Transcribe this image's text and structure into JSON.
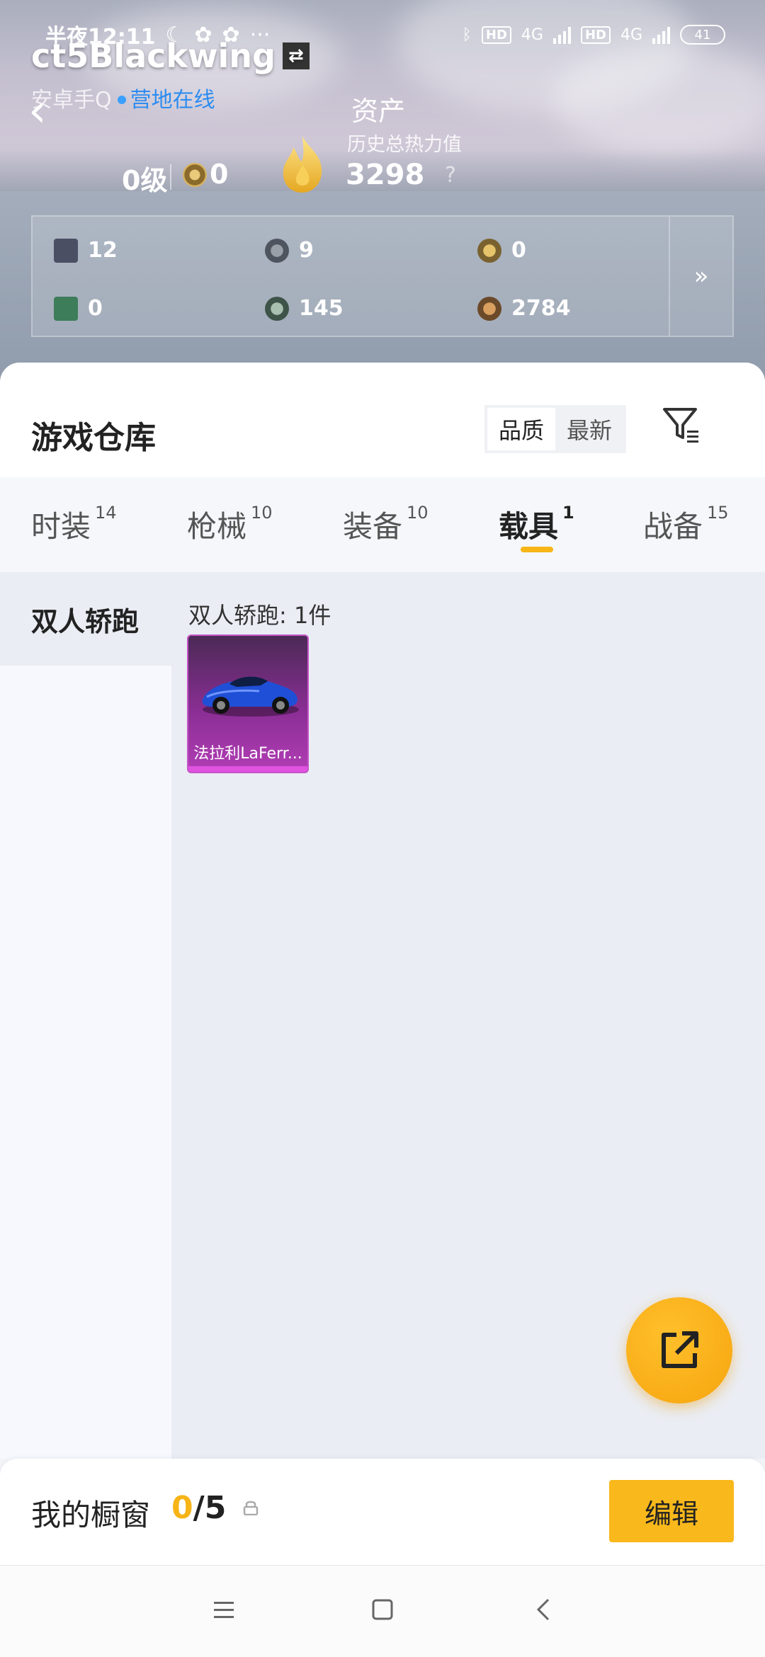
{
  "status_bar": {
    "time": "半夜12:11",
    "hd1": "HD",
    "net1": "4G",
    "hd2": "HD",
    "net2": "4G",
    "battery": "41"
  },
  "profile": {
    "username": "ct5Blackwing",
    "platform": "安卓手Q",
    "online_status": "营地在线",
    "assets_title": "资产",
    "heat_label": "历史总热力值",
    "level": "0级",
    "medal_count": "0",
    "heat_value": "3298",
    "help": "?"
  },
  "stats": [
    {
      "icon": "card-icon",
      "value": "12"
    },
    {
      "icon": "coin-icon",
      "value": "9"
    },
    {
      "icon": "badge-icon",
      "value": "0"
    },
    {
      "icon": "ticket-icon",
      "value": "0"
    },
    {
      "icon": "gem-icon",
      "value": "145"
    },
    {
      "icon": "token-icon",
      "value": "2784"
    }
  ],
  "warehouse": {
    "title": "游戏仓库",
    "sort_options": [
      "品质",
      "最新"
    ],
    "tabs": [
      {
        "label": "时装",
        "count": "14"
      },
      {
        "label": "枪械",
        "count": "10"
      },
      {
        "label": "装备",
        "count": "10"
      },
      {
        "label": "载具",
        "count": "1"
      },
      {
        "label": "战备",
        "count": "15"
      }
    ],
    "side_category": "双人轿跑",
    "category_count": "双人轿跑: 1件",
    "items": [
      {
        "name": "法拉利LaFerr..."
      }
    ]
  },
  "showcase": {
    "label": "我的橱窗",
    "current": "0",
    "total": "/5",
    "edit": "编辑"
  },
  "colors": {
    "accent": "#f9b81b",
    "online": "#2d8cf0",
    "item_purple": "#8a2e94"
  }
}
